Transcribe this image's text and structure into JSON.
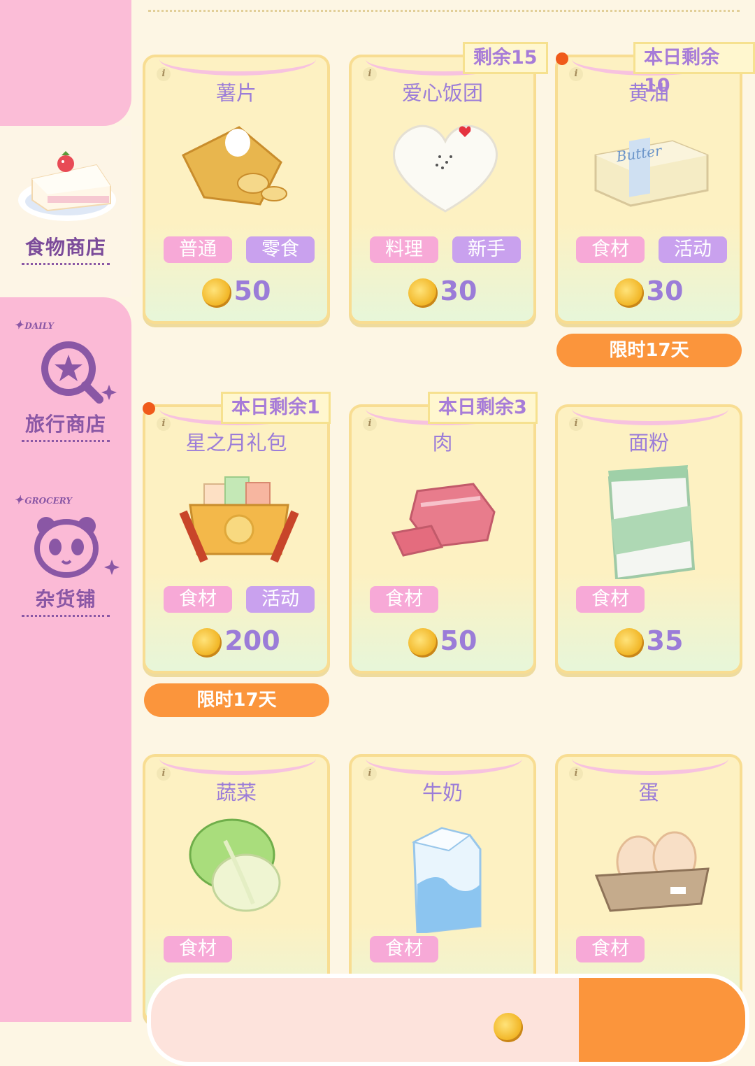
{
  "sidebar": {
    "items": [
      {
        "label": "食物商店",
        "tag": ""
      },
      {
        "label": "旅行商店",
        "tag": "DAILY"
      },
      {
        "label": "杂货铺",
        "tag": "GROCERY"
      }
    ]
  },
  "products": [
    {
      "name": "薯片",
      "tags": [
        "普通",
        "零食"
      ],
      "price": "50"
    },
    {
      "name": "爱心饭团",
      "tags": [
        "料理",
        "新手"
      ],
      "price": "30",
      "badge": "剩余15"
    },
    {
      "name": "黄油",
      "tags": [
        "食材",
        "活动"
      ],
      "price": "30",
      "badge": "本日剩余10",
      "limit": "限时17天"
    },
    {
      "name": "星之月礼包",
      "tags": [
        "食材",
        "活动"
      ],
      "price": "200",
      "badge": "本日剩余1",
      "limit": "限时17天"
    },
    {
      "name": "肉",
      "tags": [
        "食材"
      ],
      "price": "50",
      "badge": "本日剩余3"
    },
    {
      "name": "面粉",
      "tags": [
        "食材"
      ],
      "price": "35"
    },
    {
      "name": "蔬菜",
      "tags": [
        "食材"
      ],
      "price": ""
    },
    {
      "name": "牛奶",
      "tags": [
        "食材"
      ],
      "price": ""
    },
    {
      "name": "蛋",
      "tags": [
        "食材"
      ],
      "price": ""
    }
  ],
  "butter_label": "Butter",
  "colors": {
    "accent_purple": "#9b7cd8",
    "sidebar_pink": "#fbbad6",
    "limit_orange": "#fb953c"
  }
}
